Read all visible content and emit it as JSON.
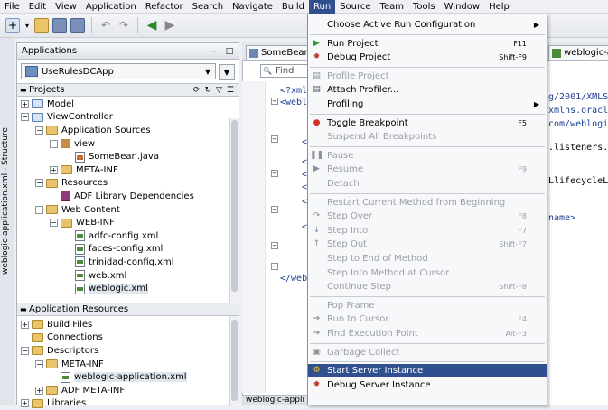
{
  "menubar": [
    "File",
    "Edit",
    "View",
    "Application",
    "Refactor",
    "Search",
    "Navigate",
    "Build",
    "Run",
    "Source",
    "Team",
    "Tools",
    "Window",
    "Help"
  ],
  "vertical_tab": "weblogic-application.xml - Structure",
  "applications_panel": {
    "title": "Applications",
    "selected_app": "UseRulesDCApp",
    "projects_label": "Projects",
    "tree": [
      {
        "label": "Model",
        "indent": 0,
        "exp": "+",
        "icon": "folder-blue"
      },
      {
        "label": "ViewController",
        "indent": 0,
        "exp": "-",
        "icon": "folder-blue"
      },
      {
        "label": "Application Sources",
        "indent": 1,
        "exp": "-",
        "icon": "folder"
      },
      {
        "label": "view",
        "indent": 2,
        "exp": "-",
        "icon": "package"
      },
      {
        "label": "SomeBean.java",
        "indent": 3,
        "exp": "",
        "icon": "java"
      },
      {
        "label": "META-INF",
        "indent": 2,
        "exp": "+",
        "icon": "folder"
      },
      {
        "label": "Resources",
        "indent": 1,
        "exp": "-",
        "icon": "folder"
      },
      {
        "label": "ADF Library Dependencies",
        "indent": 2,
        "exp": "",
        "icon": "lib"
      },
      {
        "label": "Web Content",
        "indent": 1,
        "exp": "-",
        "icon": "folder"
      },
      {
        "label": "WEB-INF",
        "indent": 2,
        "exp": "-",
        "icon": "folder"
      },
      {
        "label": "adfc-config.xml",
        "indent": 3,
        "exp": "",
        "icon": "xml"
      },
      {
        "label": "faces-config.xml",
        "indent": 3,
        "exp": "",
        "icon": "xml"
      },
      {
        "label": "trinidad-config.xml",
        "indent": 3,
        "exp": "",
        "icon": "xml"
      },
      {
        "label": "web.xml",
        "indent": 3,
        "exp": "",
        "icon": "xml"
      },
      {
        "label": "weblogic.xml",
        "indent": 3,
        "exp": "",
        "icon": "xml",
        "selected": true
      }
    ],
    "app_resources_label": "Application Resources",
    "res_tree": [
      {
        "label": "Build Files",
        "indent": 0,
        "exp": "+",
        "icon": "folder"
      },
      {
        "label": "Connections",
        "indent": 0,
        "exp": "",
        "icon": "folder"
      },
      {
        "label": "Descriptors",
        "indent": 0,
        "exp": "-",
        "icon": "folder"
      },
      {
        "label": "META-INF",
        "indent": 1,
        "exp": "-",
        "icon": "folder"
      },
      {
        "label": "weblogic-application.xml",
        "indent": 2,
        "exp": "",
        "icon": "xml",
        "selected": true
      },
      {
        "label": "ADF META-INF",
        "indent": 1,
        "exp": "+",
        "icon": "folder"
      },
      {
        "label": "Libraries",
        "indent": 0,
        "exp": "+",
        "icon": "folder"
      }
    ]
  },
  "editor": {
    "tab_label": "SomeBean.j",
    "find_placeholder": "Find",
    "code_lines": [
      "<?xml",
      "<webl",
      "<",
      "<",
      "<",
      "<",
      "<",
      "</",
      "</web"
    ],
    "bottom_tab": "weblogic-appli"
  },
  "right_editor": {
    "tab_label": "weblogic-ap",
    "lines": [
      "g/2001/XMLS",
      "xmlns.oracl",
      "com/weblogi",
      ".listeners.",
      "LlifecycleL",
      "name>"
    ]
  },
  "run_menu": {
    "items": [
      {
        "label": "Choose Active Run Configuration",
        "u": "v",
        "accel": "",
        "submenu": true,
        "enabled": true,
        "icon": ""
      },
      {
        "sep": true
      },
      {
        "label": "Run Project",
        "u": "R",
        "accel": "F11",
        "enabled": true,
        "icon": "run-icon"
      },
      {
        "label": "Debug Project",
        "u": "D",
        "accel": "Shift-F9",
        "enabled": true,
        "icon": "debug-icon"
      },
      {
        "sep": true
      },
      {
        "label": "Profile Project",
        "u": "P",
        "accel": "",
        "enabled": false,
        "icon": "profile-icon"
      },
      {
        "label": "Attach Profiler...",
        "u": "A",
        "accel": "",
        "enabled": true,
        "icon": "attach-profiler-icon"
      },
      {
        "label": "Profiling",
        "u": "f",
        "accel": "",
        "submenu": true,
        "enabled": true,
        "icon": ""
      },
      {
        "sep": true
      },
      {
        "label": "Toggle Breakpoint",
        "u": "T",
        "accel": "F5",
        "enabled": true,
        "icon": "breakpoint-icon"
      },
      {
        "label": "Suspend All Breakpoints",
        "u": "S",
        "accel": "",
        "enabled": false,
        "icon": ""
      },
      {
        "sep": true
      },
      {
        "label": "Pause",
        "u": "P",
        "accel": "",
        "enabled": false,
        "icon": "pause-icon"
      },
      {
        "label": "Resume",
        "u": "R",
        "accel": "F9",
        "enabled": false,
        "icon": "resume-icon"
      },
      {
        "label": "Detach",
        "u": "h",
        "accel": "",
        "enabled": false,
        "icon": ""
      },
      {
        "sep": true
      },
      {
        "label": "Restart Current Method from Beginning",
        "u": "",
        "accel": "",
        "enabled": false,
        "icon": ""
      },
      {
        "label": "Step Over",
        "u": "O",
        "accel": "F8",
        "enabled": false,
        "icon": "step-over-icon"
      },
      {
        "label": "Step Into",
        "u": "I",
        "accel": "F7",
        "enabled": false,
        "icon": "step-into-icon"
      },
      {
        "label": "Step Out",
        "u": "O",
        "accel": "Shift-F7",
        "enabled": false,
        "icon": "step-out-icon"
      },
      {
        "label": "Step to End of Method",
        "u": "M",
        "accel": "",
        "enabled": false,
        "icon": ""
      },
      {
        "label": "Step Into Method at Cursor",
        "u": "",
        "accel": "",
        "enabled": false,
        "icon": ""
      },
      {
        "label": "Continue Step",
        "u": "C",
        "accel": "Shift-F8",
        "enabled": false,
        "icon": ""
      },
      {
        "sep": true
      },
      {
        "label": "Pop Frame",
        "u": "F",
        "accel": "",
        "enabled": false,
        "icon": ""
      },
      {
        "label": "Run to Cursor",
        "u": "u",
        "accel": "F4",
        "enabled": false,
        "icon": "run-to-cursor-icon"
      },
      {
        "label": "Find Execution Point",
        "u": "E",
        "accel": "Alt-F3",
        "enabled": false,
        "icon": "find-execution-point-icon"
      },
      {
        "sep": true
      },
      {
        "label": "Garbage Collect",
        "u": "G",
        "accel": "",
        "enabled": false,
        "icon": "garbage-collect-icon"
      },
      {
        "sep": true
      },
      {
        "label": "Start Server Instance",
        "u": "S",
        "accel": "",
        "enabled": true,
        "highlighted": true,
        "icon": "start-server-icon"
      },
      {
        "label": "Debug Server Instance",
        "u": "D",
        "accel": "",
        "enabled": true,
        "icon": "debug-server-icon"
      }
    ]
  },
  "colors": {
    "menu_highlight": "#2f4f8e",
    "disabled_text": "#9a9ea5"
  }
}
